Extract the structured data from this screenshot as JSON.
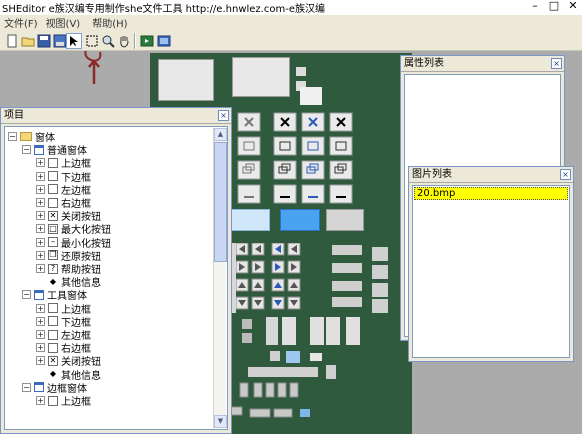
{
  "window": {
    "title": "SHEditor  e族汉编专用制作she文件工具  http://e.hnwlez.com-e族汉编"
  },
  "menu": [
    "文件(F)",
    "视图(V)",
    "帮助(H)"
  ],
  "toolbar": [
    "new-file",
    "open-folder",
    "save",
    "save-as",
    "select-arrow",
    "marquee-select",
    "zoom",
    "pan-hand",
    "preview",
    "export"
  ],
  "project_panel": {
    "title": "项目",
    "tree": [
      {
        "label": "窗体",
        "level": 0,
        "toggle": "−",
        "icon": "folder"
      },
      {
        "label": "普通窗体",
        "level": 1,
        "toggle": "−",
        "icon": "window"
      },
      {
        "label": "上边框",
        "level": 2,
        "toggle": "+",
        "icon": "box"
      },
      {
        "label": "下边框",
        "level": 2,
        "toggle": "+",
        "icon": "box"
      },
      {
        "label": "左边框",
        "level": 2,
        "toggle": "+",
        "icon": "box"
      },
      {
        "label": "右边框",
        "level": 2,
        "toggle": "+",
        "icon": "box"
      },
      {
        "label": "关闭按钮",
        "level": 2,
        "toggle": "+",
        "icon": "close"
      },
      {
        "label": "最大化按钮",
        "level": 2,
        "toggle": "+",
        "icon": "max"
      },
      {
        "label": "最小化按钮",
        "level": 2,
        "toggle": "+",
        "icon": "min"
      },
      {
        "label": "还原按钮",
        "level": 2,
        "toggle": "+",
        "icon": "restore"
      },
      {
        "label": "帮助按钮",
        "level": 2,
        "toggle": "+",
        "icon": "help"
      },
      {
        "label": "其他信息",
        "level": 2,
        "toggle": "",
        "icon": "dot"
      },
      {
        "label": "工具窗体",
        "level": 1,
        "toggle": "−",
        "icon": "window"
      },
      {
        "label": "上边框",
        "level": 2,
        "toggle": "+",
        "icon": "box"
      },
      {
        "label": "下边框",
        "level": 2,
        "toggle": "+",
        "icon": "box"
      },
      {
        "label": "左边框",
        "level": 2,
        "toggle": "+",
        "icon": "box"
      },
      {
        "label": "右边框",
        "level": 2,
        "toggle": "+",
        "icon": "box"
      },
      {
        "label": "关闭按钮",
        "level": 2,
        "toggle": "+",
        "icon": "close"
      },
      {
        "label": "其他信息",
        "level": 2,
        "toggle": "",
        "icon": "dot"
      },
      {
        "label": "边框窗体",
        "level": 1,
        "toggle": "−",
        "icon": "window"
      },
      {
        "label": "上边框",
        "level": 2,
        "toggle": "+",
        "icon": "box"
      }
    ]
  },
  "property_panel": {
    "title": "属性列表"
  },
  "image_panel": {
    "title": "图片列表",
    "items": [
      "20.bmp"
    ]
  },
  "colors": {
    "canvas": "#2f5a3d",
    "workspace": "#ababab",
    "selection": "#ffff00",
    "annotation": "#8b2a2a"
  }
}
